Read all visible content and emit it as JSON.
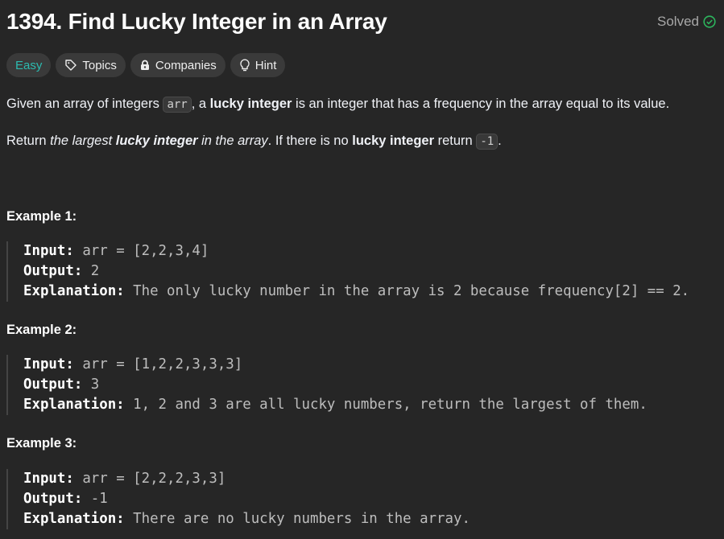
{
  "title": "1394. Find Lucky Integer in an Array",
  "status": {
    "label": "Solved",
    "icon": "check-circle-icon",
    "color": "#2db55d"
  },
  "tags": {
    "difficulty": "Easy",
    "topics": "Topics",
    "companies": "Companies",
    "hint": "Hint"
  },
  "description": {
    "p1": {
      "a": "Given an array of integers ",
      "code": "arr",
      "b": ", a ",
      "bold": "lucky integer",
      "c": " is an integer that has a frequency in the array equal to its value."
    },
    "p2": {
      "a": "Return ",
      "i1": "the largest ",
      "bi": "lucky integer",
      "i2": " in the array",
      "b": ". If there is no ",
      "bold": "lucky integer",
      "c": " return ",
      "code": "-1",
      "d": "."
    }
  },
  "examples": [
    {
      "heading": "Example 1:",
      "input_label": "Input:",
      "input": "arr = [2,2,3,4]",
      "output_label": "Output:",
      "output": "2",
      "explanation_label": "Explanation:",
      "explanation": "The only lucky number in the array is 2 because frequency[2] == 2."
    },
    {
      "heading": "Example 2:",
      "input_label": "Input:",
      "input": "arr = [1,2,2,3,3,3]",
      "output_label": "Output:",
      "output": "3",
      "explanation_label": "Explanation:",
      "explanation": "1, 2 and 3 are all lucky numbers, return the largest of them."
    },
    {
      "heading": "Example 3:",
      "input_label": "Input:",
      "input": "arr = [2,2,2,3,3]",
      "output_label": "Output:",
      "output": "-1",
      "explanation_label": "Explanation:",
      "explanation": "There are no lucky numbers in the array."
    }
  ]
}
